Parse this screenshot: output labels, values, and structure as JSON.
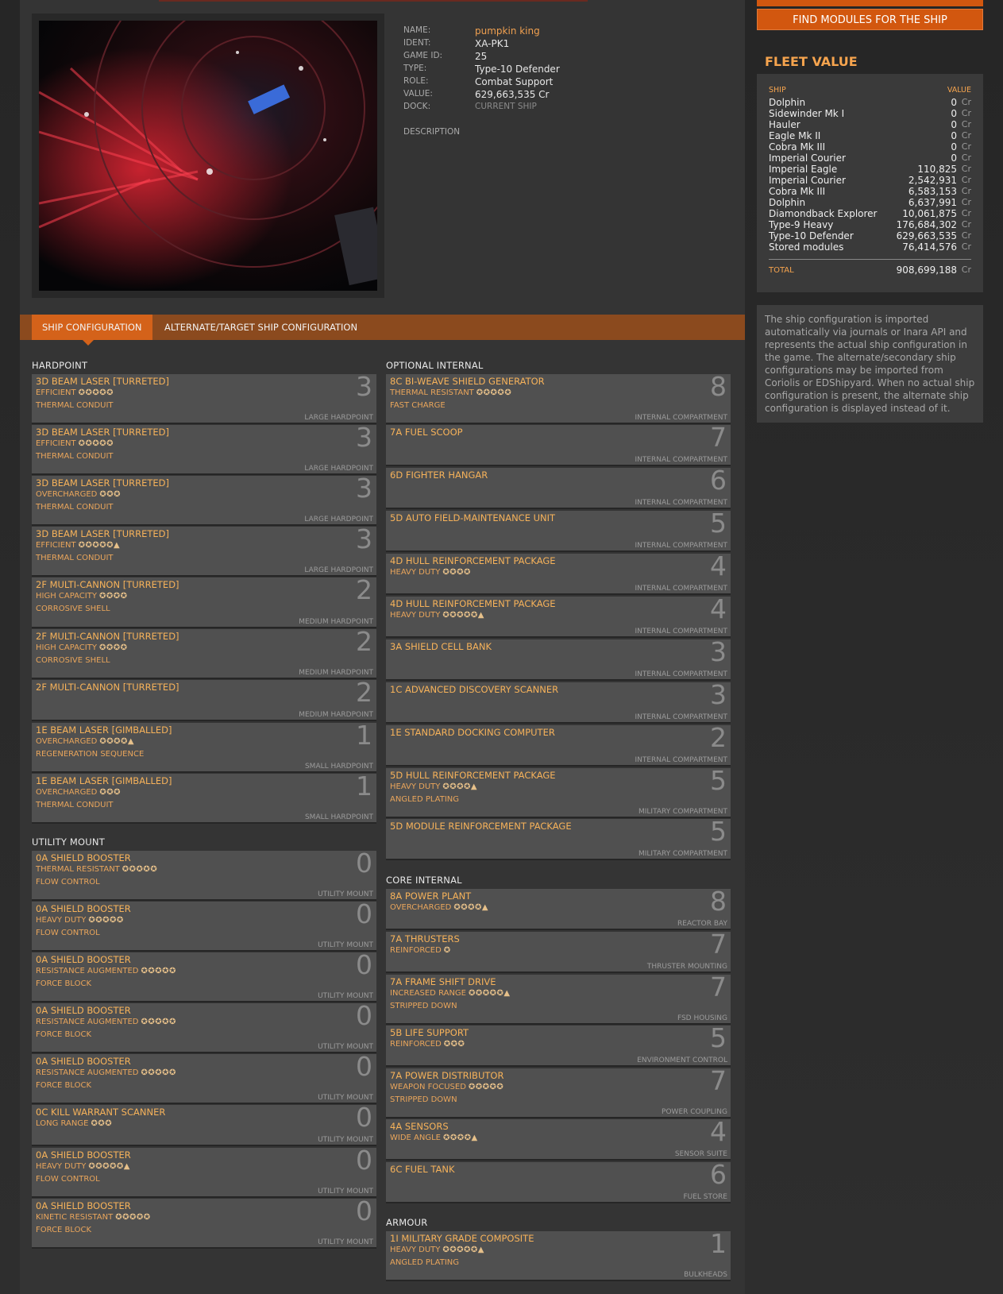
{
  "ship": {
    "labels": {
      "name": "NAME:",
      "ident": "IDENT:",
      "game_id": "GAME ID:",
      "type": "TYPE:",
      "role": "ROLE:",
      "value": "VALUE:",
      "dock": "DOCK:",
      "description": "DESCRIPTION"
    },
    "name": "pumpkin king",
    "ident": "XA-PK1",
    "game_id": "25",
    "type": "Type-10 Defender",
    "role": "Combat Support",
    "value": "629,663,535 Cr",
    "dock": "CURRENT SHIP"
  },
  "tabs": {
    "active": "SHIP CONFIGURATION",
    "alternate": "ALTERNATE/TARGET SHIP CONFIGURATION"
  },
  "sections": {
    "hardpoint": "HARDPOINT",
    "utility": "UTILITY MOUNT",
    "optional": "OPTIONAL INTERNAL",
    "core": "CORE INTERNAL",
    "armour": "ARMOUR"
  },
  "hardpoints": [
    {
      "name": "3D BEAM LASER [TURRETED]",
      "eng": "EFFICIENT",
      "pips": "✪✪✪✪✪",
      "exp": "THERMAL CONDUIT",
      "size": "3",
      "type": "LARGE HARDPOINT"
    },
    {
      "name": "3D BEAM LASER [TURRETED]",
      "eng": "EFFICIENT",
      "pips": "✪✪✪✪✪",
      "exp": "THERMAL CONDUIT",
      "size": "3",
      "type": "LARGE HARDPOINT"
    },
    {
      "name": "3D BEAM LASER [TURRETED]",
      "eng": "OVERCHARGED",
      "pips": "✪✪✪",
      "exp": "THERMAL CONDUIT",
      "size": "3",
      "type": "LARGE HARDPOINT"
    },
    {
      "name": "3D BEAM LASER [TURRETED]",
      "eng": "EFFICIENT",
      "pips": "✪✪✪✪✪▲",
      "exp": "THERMAL CONDUIT",
      "size": "3",
      "type": "LARGE HARDPOINT"
    },
    {
      "name": "2F MULTI-CANNON [TURRETED]",
      "eng": "HIGH CAPACITY",
      "pips": "✪✪✪✪",
      "exp": "CORROSIVE SHELL",
      "size": "2",
      "type": "MEDIUM HARDPOINT"
    },
    {
      "name": "2F MULTI-CANNON [TURRETED]",
      "eng": "HIGH CAPACITY",
      "pips": "✪✪✪✪",
      "exp": "CORROSIVE SHELL",
      "size": "2",
      "type": "MEDIUM HARDPOINT"
    },
    {
      "name": "2F MULTI-CANNON [TURRETED]",
      "eng": "",
      "pips": "",
      "exp": "",
      "size": "2",
      "type": "MEDIUM HARDPOINT"
    },
    {
      "name": "1E BEAM LASER [GIMBALLED]",
      "eng": "OVERCHARGED",
      "pips": "✪✪✪✪▲",
      "exp": "REGENERATION SEQUENCE",
      "size": "1",
      "type": "SMALL HARDPOINT"
    },
    {
      "name": "1E BEAM LASER [GIMBALLED]",
      "eng": "OVERCHARGED",
      "pips": "✪✪✪",
      "exp": "THERMAL CONDUIT",
      "size": "1",
      "type": "SMALL HARDPOINT"
    }
  ],
  "utilities": [
    {
      "name": "0A SHIELD BOOSTER",
      "eng": "THERMAL RESISTANT",
      "pips": "✪✪✪✪✪",
      "exp": "FLOW CONTROL",
      "size": "0",
      "type": "UTILITY MOUNT"
    },
    {
      "name": "0A SHIELD BOOSTER",
      "eng": "HEAVY DUTY",
      "pips": "✪✪✪✪✪",
      "exp": "FLOW CONTROL",
      "size": "0",
      "type": "UTILITY MOUNT"
    },
    {
      "name": "0A SHIELD BOOSTER",
      "eng": "RESISTANCE AUGMENTED",
      "pips": "✪✪✪✪✪",
      "exp": "FORCE BLOCK",
      "size": "0",
      "type": "UTILITY MOUNT"
    },
    {
      "name": "0A SHIELD BOOSTER",
      "eng": "RESISTANCE AUGMENTED",
      "pips": "✪✪✪✪✪",
      "exp": "FORCE BLOCK",
      "size": "0",
      "type": "UTILITY MOUNT"
    },
    {
      "name": "0A SHIELD BOOSTER",
      "eng": "RESISTANCE AUGMENTED",
      "pips": "✪✪✪✪✪",
      "exp": "FORCE BLOCK",
      "size": "0",
      "type": "UTILITY MOUNT"
    },
    {
      "name": "0C KILL WARRANT SCANNER",
      "eng": "LONG RANGE",
      "pips": "✪✪✪",
      "exp": "",
      "size": "0",
      "type": "UTILITY MOUNT"
    },
    {
      "name": "0A SHIELD BOOSTER",
      "eng": "HEAVY DUTY",
      "pips": "✪✪✪✪✪▲",
      "exp": "FLOW CONTROL",
      "size": "0",
      "type": "UTILITY MOUNT"
    },
    {
      "name": "0A SHIELD BOOSTER",
      "eng": "KINETIC RESISTANT",
      "pips": "✪✪✪✪✪",
      "exp": "FORCE BLOCK",
      "size": "0",
      "type": "UTILITY MOUNT"
    }
  ],
  "optional": [
    {
      "name": "8C BI-WEAVE SHIELD GENERATOR",
      "eng": "THERMAL RESISTANT",
      "pips": "✪✪✪✪✪",
      "exp": "FAST CHARGE",
      "size": "8",
      "type": "INTERNAL COMPARTMENT"
    },
    {
      "name": "7A FUEL SCOOP",
      "eng": "",
      "pips": "",
      "exp": "",
      "size": "7",
      "type": "INTERNAL COMPARTMENT"
    },
    {
      "name": "6D FIGHTER HANGAR",
      "eng": "",
      "pips": "",
      "exp": "",
      "size": "6",
      "type": "INTERNAL COMPARTMENT"
    },
    {
      "name": "5D AUTO FIELD-MAINTENANCE UNIT",
      "eng": "",
      "pips": "",
      "exp": "",
      "size": "5",
      "type": "INTERNAL COMPARTMENT"
    },
    {
      "name": "4D HULL REINFORCEMENT PACKAGE",
      "eng": "HEAVY DUTY",
      "pips": "✪✪✪✪",
      "exp": "",
      "size": "4",
      "type": "INTERNAL COMPARTMENT"
    },
    {
      "name": "4D HULL REINFORCEMENT PACKAGE",
      "eng": "HEAVY DUTY",
      "pips": "✪✪✪✪✪▲",
      "exp": "",
      "size": "4",
      "type": "INTERNAL COMPARTMENT"
    },
    {
      "name": "3A SHIELD CELL BANK",
      "eng": "",
      "pips": "",
      "exp": "",
      "size": "3",
      "type": "INTERNAL COMPARTMENT"
    },
    {
      "name": "1C ADVANCED DISCOVERY SCANNER",
      "eng": "",
      "pips": "",
      "exp": "",
      "size": "3",
      "type": "INTERNAL COMPARTMENT"
    },
    {
      "name": "1E STANDARD DOCKING COMPUTER",
      "eng": "",
      "pips": "",
      "exp": "",
      "size": "2",
      "type": "INTERNAL COMPARTMENT"
    },
    {
      "name": "5D HULL REINFORCEMENT PACKAGE",
      "eng": "HEAVY DUTY",
      "pips": "✪✪✪✪▲",
      "exp": "ANGLED PLATING",
      "size": "5",
      "type": "MILITARY COMPARTMENT"
    },
    {
      "name": "5D MODULE REINFORCEMENT PACKAGE",
      "eng": "",
      "pips": "",
      "exp": "",
      "size": "5",
      "type": "MILITARY COMPARTMENT"
    }
  ],
  "core": [
    {
      "name": "8A POWER PLANT",
      "eng": "OVERCHARGED",
      "pips": "✪✪✪✪▲",
      "exp": "",
      "size": "8",
      "type": "REACTOR BAY"
    },
    {
      "name": "7A THRUSTERS",
      "eng": "REINFORCED",
      "pips": "✪",
      "exp": "",
      "size": "7",
      "type": "THRUSTER MOUNTING"
    },
    {
      "name": "7A FRAME SHIFT DRIVE",
      "eng": "INCREASED RANGE",
      "pips": "✪✪✪✪✪▲",
      "exp": "STRIPPED DOWN",
      "size": "7",
      "type": "FSD HOUSING"
    },
    {
      "name": "5B LIFE SUPPORT",
      "eng": "REINFORCED",
      "pips": "✪✪✪",
      "exp": "",
      "size": "5",
      "type": "ENVIRONMENT CONTROL"
    },
    {
      "name": "7A POWER DISTRIBUTOR",
      "eng": "WEAPON FOCUSED",
      "pips": "✪✪✪✪✪",
      "exp": "STRIPPED DOWN",
      "size": "7",
      "type": "POWER COUPLING"
    },
    {
      "name": "4A SENSORS",
      "eng": "WIDE ANGLE",
      "pips": "✪✪✪✪▲",
      "exp": "",
      "size": "4",
      "type": "SENSOR SUITE"
    },
    {
      "name": "6C FUEL TANK",
      "eng": "",
      "pips": "",
      "exp": "",
      "size": "6",
      "type": "FUEL STORE"
    }
  ],
  "armour": [
    {
      "name": "1I MILITARY GRADE COMPOSITE",
      "eng": "HEAVY DUTY",
      "pips": "✪✪✪✪✪▲",
      "exp": "ANGLED PLATING",
      "size": "1",
      "type": "BULKHEADS"
    }
  ],
  "find_button": "FIND MODULES FOR THE SHIP",
  "fleet": {
    "title": "FLEET VALUE",
    "col_ship": "SHIP",
    "col_value": "VALUE",
    "currency": "Cr",
    "rows": [
      {
        "ship": "Dolphin",
        "value": "0"
      },
      {
        "ship": "Sidewinder Mk I",
        "value": "0"
      },
      {
        "ship": "Hauler",
        "value": "0"
      },
      {
        "ship": "Eagle Mk II",
        "value": "0"
      },
      {
        "ship": "Cobra Mk III",
        "value": "0"
      },
      {
        "ship": "Imperial Courier",
        "value": "0"
      },
      {
        "ship": "Imperial Eagle",
        "value": "110,825"
      },
      {
        "ship": "Imperial Courier",
        "value": "2,542,931"
      },
      {
        "ship": "Cobra Mk III",
        "value": "6,583,153"
      },
      {
        "ship": "Dolphin",
        "value": "6,637,991"
      },
      {
        "ship": "Diamondback Explorer",
        "value": "10,061,875"
      },
      {
        "ship": "Type-9 Heavy",
        "value": "176,684,302"
      },
      {
        "ship": "Type-10 Defender",
        "value": "629,663,535"
      },
      {
        "ship": "Stored modules",
        "value": "76,414,576"
      }
    ],
    "total_label": "TOTAL",
    "total_value": "908,699,188"
  },
  "note": "The ship configuration is imported automatically via journals or Inara API and represents the actual ship configuration in the game. The alternate/secondary ship configurations may be imported from Coriolis or EDShipyard. When no actual ship configuration is present, the alternate ship configuration is displayed instead of it."
}
